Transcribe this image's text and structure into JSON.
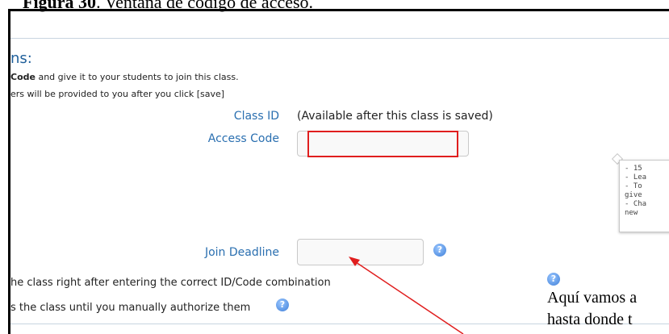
{
  "figure": {
    "caption_label": "Figura 30",
    "caption_text": ". Ventana de código de acceso."
  },
  "window": {
    "heading": "ns:",
    "instruction_1_bold": "Code",
    "instruction_1_rest": " and give it to your students to join this class.",
    "instruction_2": "ers will be provided to you after you click [save]"
  },
  "fields": {
    "class_id_label": "Class ID",
    "class_id_value": "(Available after this class is saved)",
    "access_code_label": "Access Code",
    "access_code_value": "",
    "join_deadline_label": "Join Deadline",
    "join_deadline_value": ""
  },
  "tooltip_lines": [
    "- 15",
    "- Lea",
    "- To",
    "give",
    "- Cha",
    "new"
  ],
  "options": {
    "option_1": "he class right after entering the correct ID/Code combination",
    "option_2": "s the class until you manually authorize them"
  },
  "annotation": {
    "line_1": "Aquí vamos a",
    "line_2": "hasta donde t"
  },
  "colors": {
    "highlight": "#e01e1e",
    "label_blue": "#2a6fb0",
    "arrow": "#e01e1e"
  },
  "icons": {
    "help": "question-mark-circle"
  }
}
